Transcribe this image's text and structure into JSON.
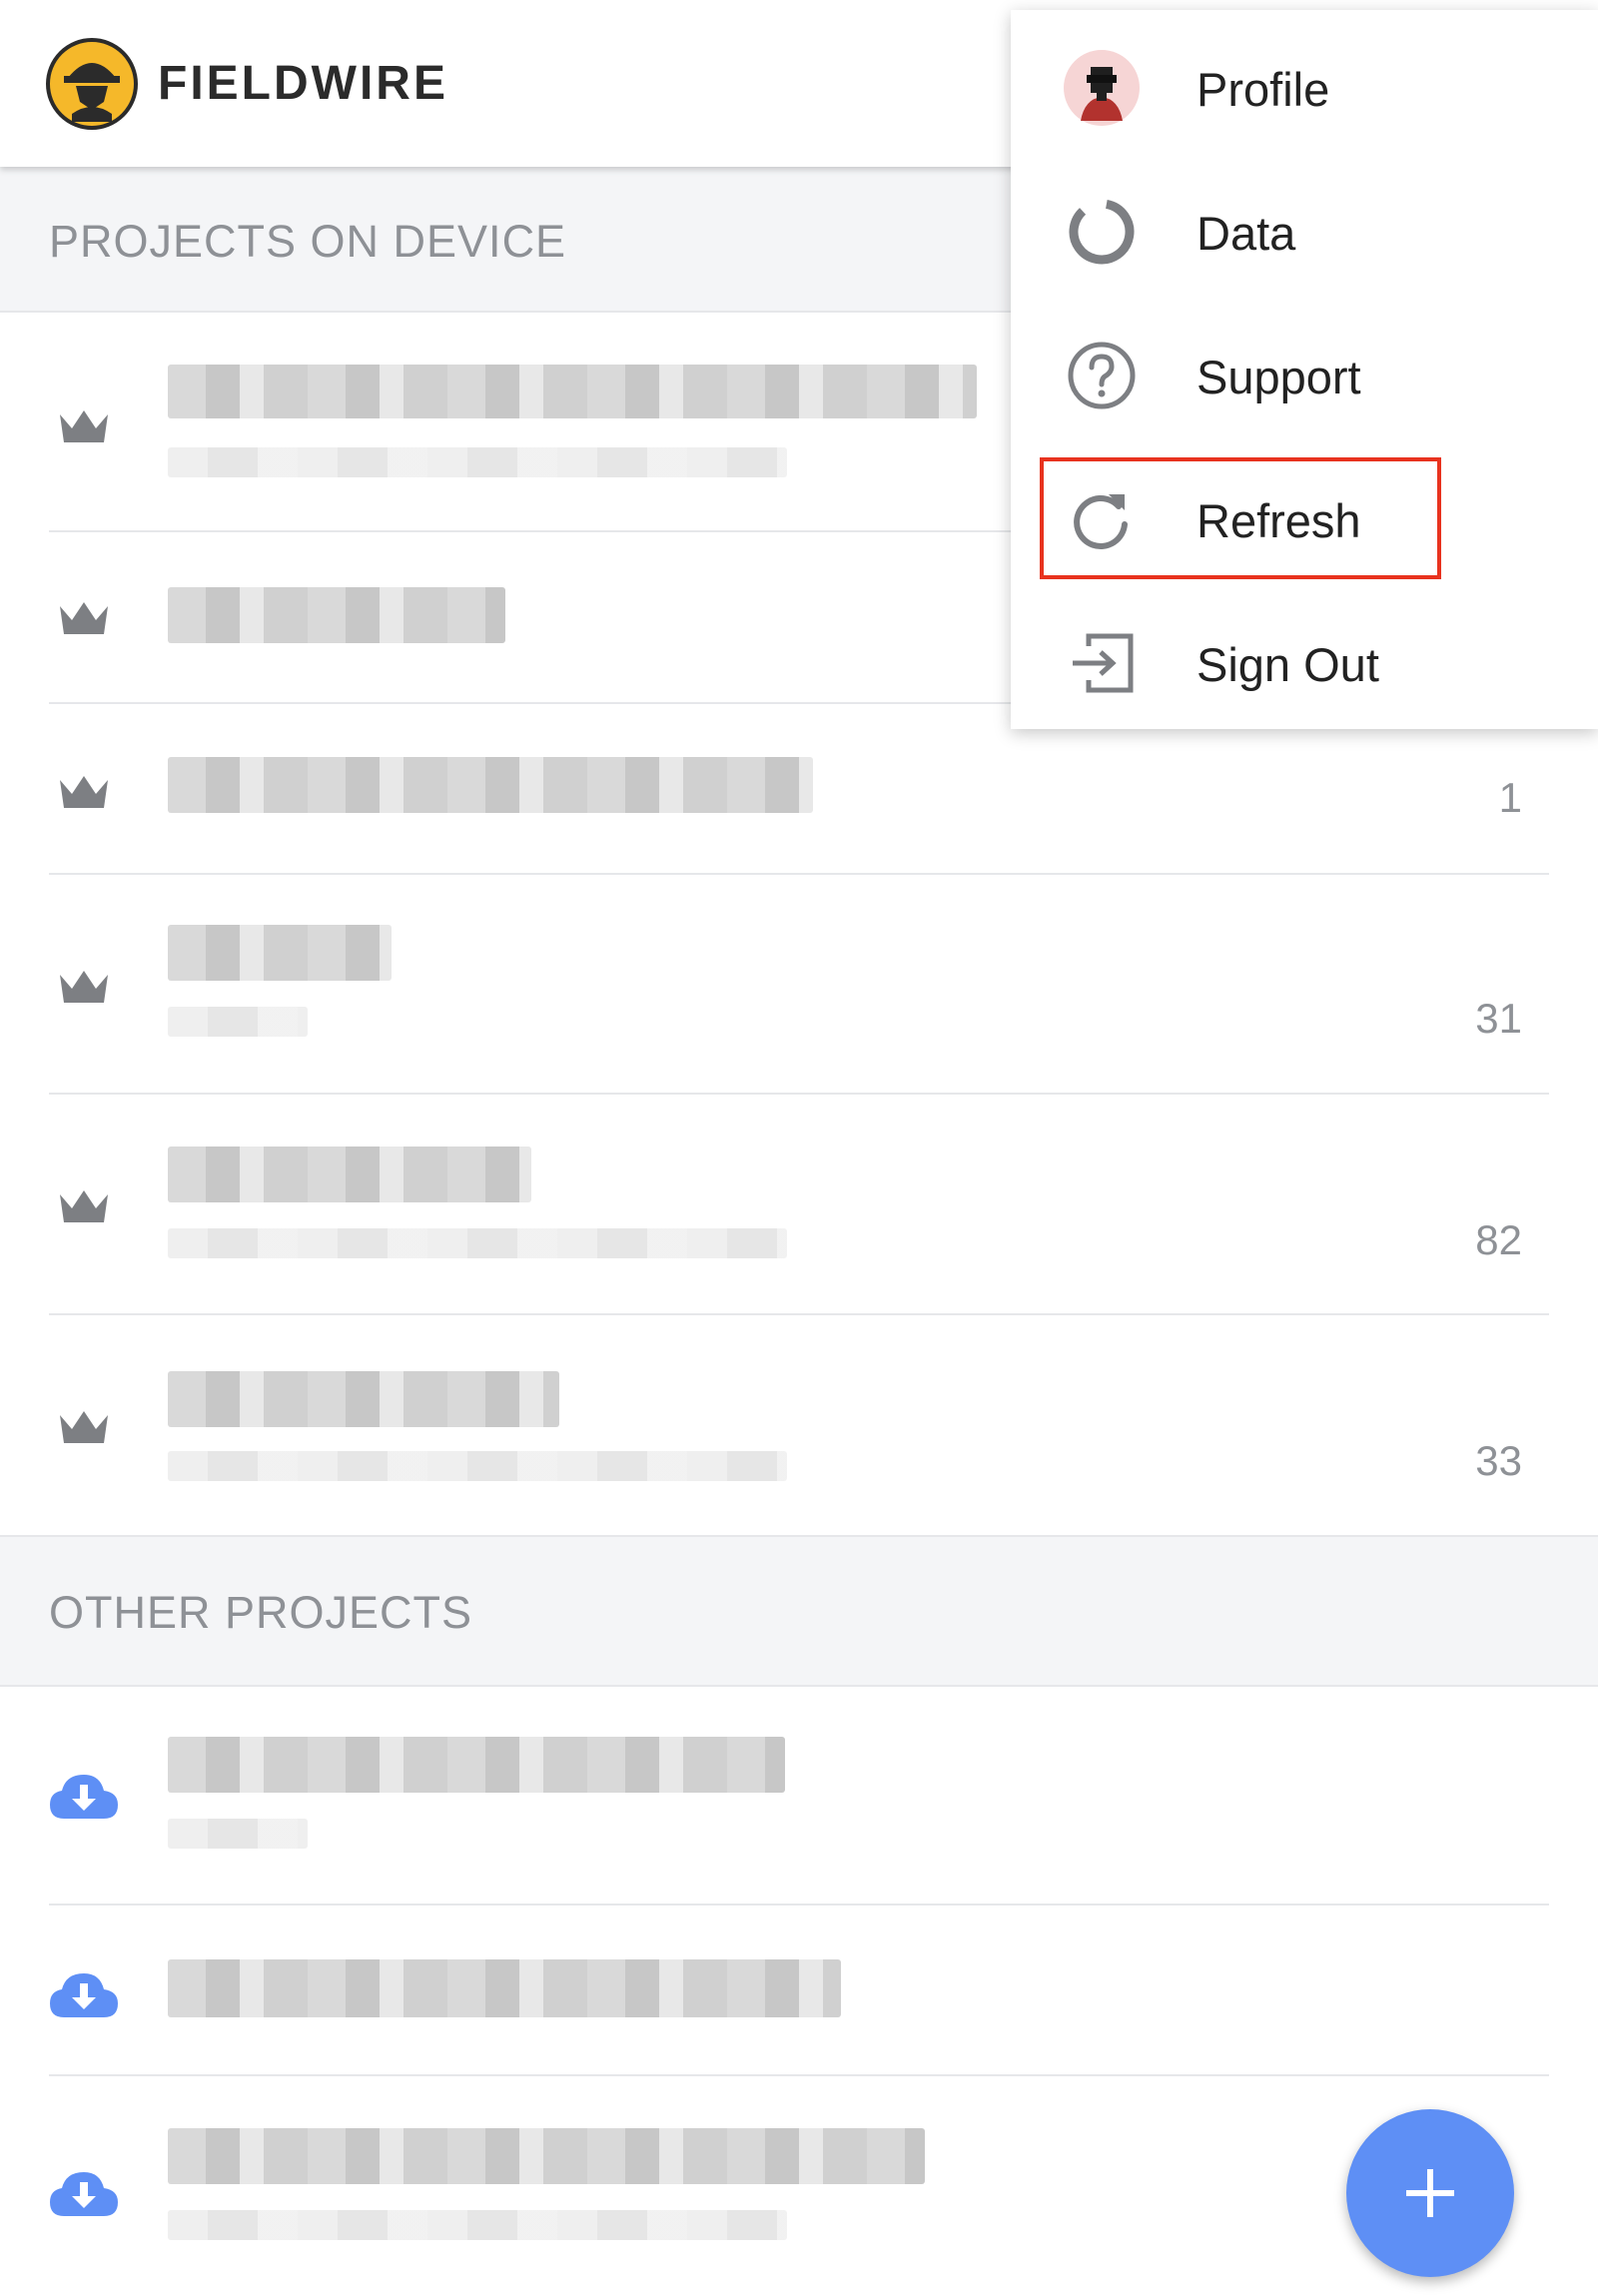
{
  "app": {
    "brand": "FIELDWIRE",
    "logo_icon": "fieldwire-worker-logo"
  },
  "sections": [
    {
      "title": "PROJECTS ON DEVICE"
    },
    {
      "title": "OTHER PROJECTS"
    }
  ],
  "device_projects": [
    {
      "icon": "crown-icon",
      "count": ""
    },
    {
      "icon": "crown-icon",
      "count": ""
    },
    {
      "icon": "crown-icon",
      "count": "1"
    },
    {
      "icon": "crown-icon",
      "count": "31"
    },
    {
      "icon": "crown-icon",
      "count": "82"
    },
    {
      "icon": "crown-icon",
      "count": "33"
    }
  ],
  "other_projects": [
    {
      "icon": "cloud-download-icon"
    },
    {
      "icon": "cloud-download-icon"
    },
    {
      "icon": "cloud-download-icon"
    }
  ],
  "menu": {
    "items": [
      {
        "label": "Profile",
        "icon": "avatar"
      },
      {
        "label": "Data",
        "icon": "donut-chart-icon"
      },
      {
        "label": "Support",
        "icon": "help-circle-icon"
      },
      {
        "label": "Refresh",
        "icon": "refresh-icon",
        "highlighted": true
      },
      {
        "label": "Sign Out",
        "icon": "sign-out-icon"
      }
    ]
  },
  "fab": {
    "icon": "plus-icon"
  },
  "colors": {
    "accent": "#5e8ff5",
    "highlight_border": "#e8321e",
    "section_bg": "#f4f5f7",
    "logo_yellow": "#f5b82a"
  }
}
